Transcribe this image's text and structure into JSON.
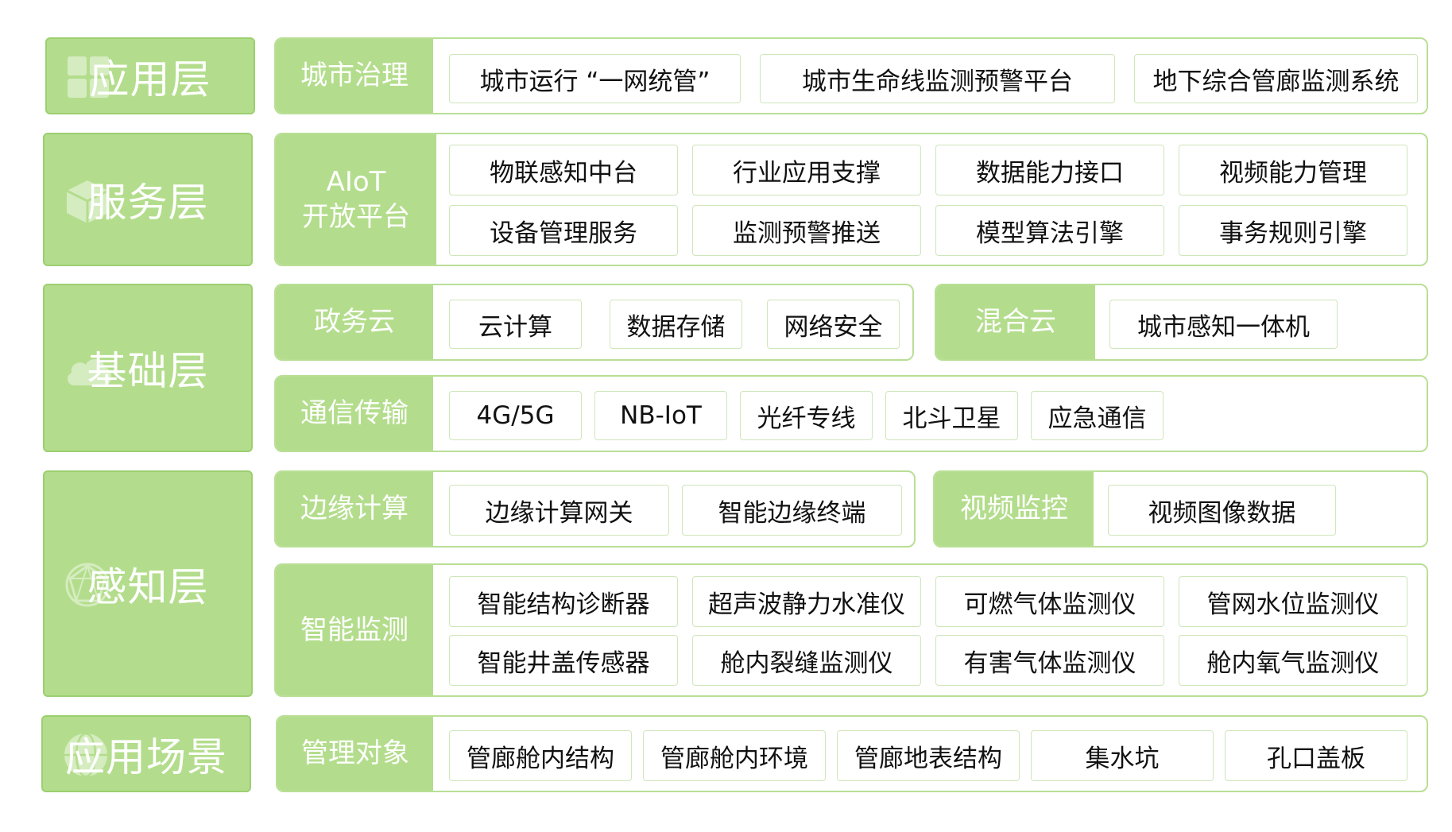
{
  "layers": {
    "application": "应用层",
    "service": "服务层",
    "infrastructure": "基础层",
    "perception": "感知层",
    "scenario": "应用场景"
  },
  "rows": {
    "city_governance": {
      "label": "城市治理",
      "items": [
        "城市运行 “一网统管”",
        "城市生命线监测预警平台",
        "地下综合管廊监测系统"
      ]
    },
    "aiot": {
      "label": "AIoT\n开放平台",
      "items": [
        "物联感知中台",
        "行业应用支撑",
        "数据能力接口",
        "视频能力管理",
        "设备管理服务",
        "监测预警推送",
        "模型算法引擎",
        "事务规则引擎"
      ]
    },
    "gov_cloud": {
      "label": "政务云",
      "items": [
        "云计算",
        "数据存储",
        "网络安全"
      ]
    },
    "hybrid_cloud": {
      "label": "混合云",
      "items": [
        "城市感知一体机"
      ]
    },
    "communication": {
      "label": "通信传输",
      "items": [
        "4G/5G",
        "NB-IoT",
        "光纤专线",
        "北斗卫星",
        "应急通信"
      ]
    },
    "edge_computing": {
      "label": "边缘计算",
      "items": [
        "边缘计算网关",
        "智能边缘终端"
      ]
    },
    "video_monitoring": {
      "label": "视频监控",
      "items": [
        "视频图像数据"
      ]
    },
    "smart_monitoring": {
      "label": "智能监测",
      "items": [
        "智能结构诊断器",
        "超声波静力水准仪",
        "可燃气体监测仪",
        "管网水位监测仪",
        "智能井盖传感器",
        "舱内裂缝监测仪",
        "有害气体监测仪",
        "舱内氧气监测仪"
      ]
    },
    "managed_objects": {
      "label": "管理对象",
      "items": [
        "管廊舱内结构",
        "管廊舱内环境",
        "管廊地表结构",
        "集水坑",
        "孔口盖板"
      ]
    }
  },
  "colors": {
    "accent": "#b3dd8c",
    "border": "#b9df96",
    "text": "#111111"
  },
  "icons": {
    "application": "grid-icon",
    "service": "cube-icon",
    "infrastructure": "cloud-icon",
    "perception": "network-icon",
    "scenario": "globe-icon"
  }
}
